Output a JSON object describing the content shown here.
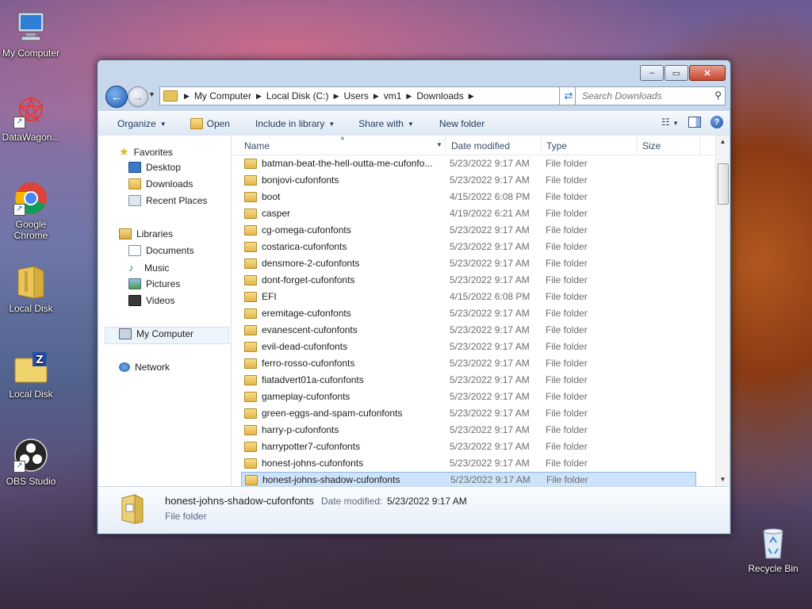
{
  "desktop": {
    "icons": [
      {
        "label": "My Computer",
        "icon": "computer-icon"
      },
      {
        "label": "DataWagon...",
        "icon": "datawagon-icon"
      },
      {
        "label": "Google Chrome",
        "icon": "chrome-icon"
      },
      {
        "label": "Local Disk",
        "icon": "folder-zip-icon"
      },
      {
        "label": "Local Disk",
        "icon": "folder-z-icon"
      },
      {
        "label": "OBS Studio",
        "icon": "obs-icon"
      },
      {
        "label": "Recycle Bin",
        "icon": "recycle-bin-icon"
      }
    ]
  },
  "window": {
    "buttons": {
      "minimize": "‒",
      "maximize": "▭",
      "close": "✕"
    },
    "address": {
      "segments": [
        "My Computer",
        "Local Disk (C:)",
        "Users",
        "vm1",
        "Downloads"
      ]
    },
    "search": {
      "placeholder": "Search Downloads"
    },
    "toolbar": {
      "organize": "Organize",
      "open": "Open",
      "include_in_library": "Include in library",
      "share_with": "Share with",
      "new_folder": "New folder"
    },
    "nav": {
      "favorites": "Favorites",
      "desktop": "Desktop",
      "downloads": "Downloads",
      "recent_places": "Recent Places",
      "libraries": "Libraries",
      "documents": "Documents",
      "music": "Music",
      "pictures": "Pictures",
      "videos": "Videos",
      "my_computer": "My Computer",
      "network": "Network"
    },
    "columns": {
      "name": "Name",
      "date_modified": "Date modified",
      "type": "Type",
      "size": "Size"
    },
    "files": [
      {
        "name": "batman-beat-the-hell-outta-me-cufonfo...",
        "date": "5/23/2022 9:17 AM",
        "type": "File folder"
      },
      {
        "name": "bonjovi-cufonfonts",
        "date": "5/23/2022 9:17 AM",
        "type": "File folder"
      },
      {
        "name": "boot",
        "date": "4/15/2022 6:08 PM",
        "type": "File folder"
      },
      {
        "name": "casper",
        "date": "4/19/2022 6:21 AM",
        "type": "File folder"
      },
      {
        "name": "cg-omega-cufonfonts",
        "date": "5/23/2022 9:17 AM",
        "type": "File folder"
      },
      {
        "name": "costarica-cufonfonts",
        "date": "5/23/2022 9:17 AM",
        "type": "File folder"
      },
      {
        "name": "densmore-2-cufonfonts",
        "date": "5/23/2022 9:17 AM",
        "type": "File folder"
      },
      {
        "name": "dont-forget-cufonfonts",
        "date": "5/23/2022 9:17 AM",
        "type": "File folder"
      },
      {
        "name": "EFI",
        "date": "4/15/2022 6:08 PM",
        "type": "File folder"
      },
      {
        "name": "eremitage-cufonfonts",
        "date": "5/23/2022 9:17 AM",
        "type": "File folder"
      },
      {
        "name": "evanescent-cufonfonts",
        "date": "5/23/2022 9:17 AM",
        "type": "File folder"
      },
      {
        "name": "evil-dead-cufonfonts",
        "date": "5/23/2022 9:17 AM",
        "type": "File folder"
      },
      {
        "name": "ferro-rosso-cufonfonts",
        "date": "5/23/2022 9:17 AM",
        "type": "File folder"
      },
      {
        "name": "fiatadvert01a-cufonfonts",
        "date": "5/23/2022 9:17 AM",
        "type": "File folder"
      },
      {
        "name": "gameplay-cufonfonts",
        "date": "5/23/2022 9:17 AM",
        "type": "File folder"
      },
      {
        "name": "green-eggs-and-spam-cufonfonts",
        "date": "5/23/2022 9:17 AM",
        "type": "File folder"
      },
      {
        "name": "harry-p-cufonfonts",
        "date": "5/23/2022 9:17 AM",
        "type": "File folder"
      },
      {
        "name": "harrypotter7-cufonfonts",
        "date": "5/23/2022 9:17 AM",
        "type": "File folder"
      },
      {
        "name": "honest-johns-cufonfonts",
        "date": "5/23/2022 9:17 AM",
        "type": "File folder"
      },
      {
        "name": "honest-johns-shadow-cufonfonts",
        "date": "5/23/2022 9:17 AM",
        "type": "File folder",
        "selected": true
      }
    ],
    "details": {
      "name": "honest-johns-shadow-cufonfonts",
      "date_label": "Date modified:",
      "date": "5/23/2022 9:17 AM",
      "type": "File folder"
    }
  },
  "colors": {
    "selection": "#cde3f9",
    "accent": "#1f5db5"
  }
}
